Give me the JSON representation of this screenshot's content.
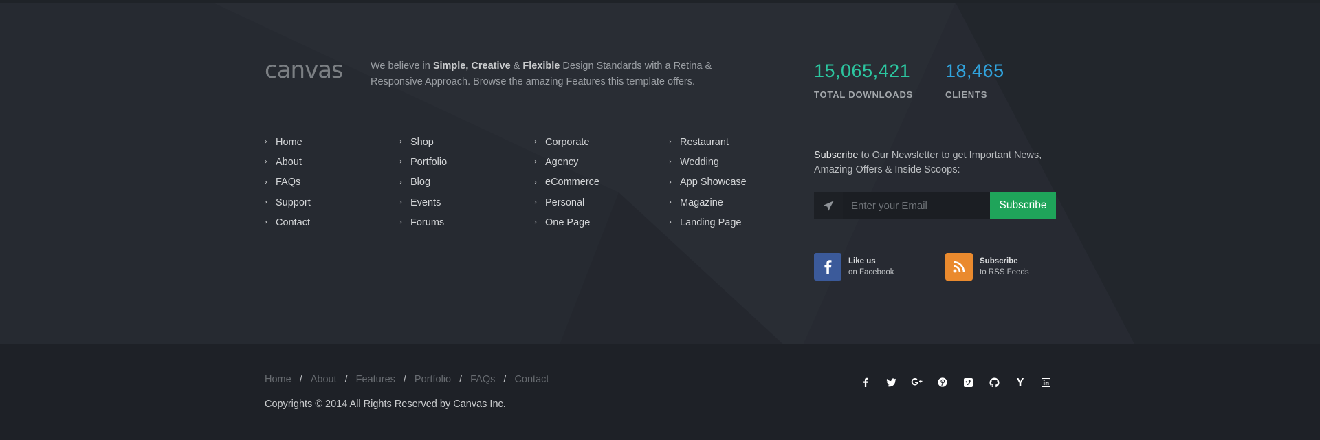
{
  "brand": {
    "logo_text": "canvas",
    "tagline_parts": [
      "We believe in ",
      "Simple, Creative",
      " & ",
      "Flexible",
      " Design Standards with a Retina & Responsive Approach. Browse the amazing Features this template offers."
    ]
  },
  "links": {
    "columns": [
      [
        "Home",
        "About",
        "FAQs",
        "Support",
        "Contact"
      ],
      [
        "Shop",
        "Portfolio",
        "Blog",
        "Events",
        "Forums"
      ],
      [
        "Corporate",
        "Agency",
        "eCommerce",
        "Personal",
        "One Page"
      ],
      [
        "Restaurant",
        "Wedding",
        "App Showcase",
        "Magazine",
        "Landing Page"
      ]
    ],
    "chevron_icon": "angle-right-icon"
  },
  "counters": [
    {
      "value": "15,065,421",
      "label": "TOTAL DOWNLOADS",
      "color": "#2cc6a0"
    },
    {
      "value": "18,465",
      "label": "CLIENTS",
      "color": "#31a3dd"
    }
  ],
  "newsletter": {
    "text_bold": "Subscribe",
    "text_rest": " to Our Newsletter to get Important News, Amazing Offers & Inside Scoops:",
    "icon": "paper-plane-icon",
    "placeholder": "Enter your Email",
    "value": "",
    "button_label": "Subscribe",
    "button_color": "#1fa45a"
  },
  "social_widgets": [
    {
      "icon": "facebook-icon",
      "line1": "Like us",
      "line2": "on Facebook",
      "color": "#3b5a9a"
    },
    {
      "icon": "rss-icon",
      "line1": "Subscribe",
      "line2": "to RSS Feeds",
      "color": "#ea8a2e"
    }
  ],
  "copyrights": {
    "links": [
      "Home",
      "About",
      "Features",
      "Portfolio",
      "FAQs",
      "Contact"
    ],
    "separator": "/",
    "text": "Copyrights © 2014 All Rights Reserved by Canvas Inc."
  },
  "social_icons": [
    "facebook-icon",
    "twitter-icon",
    "google-plus-icon",
    "pinterest-icon",
    "vimeo-icon",
    "github-icon",
    "yahoo-icon",
    "linkedin-icon"
  ]
}
